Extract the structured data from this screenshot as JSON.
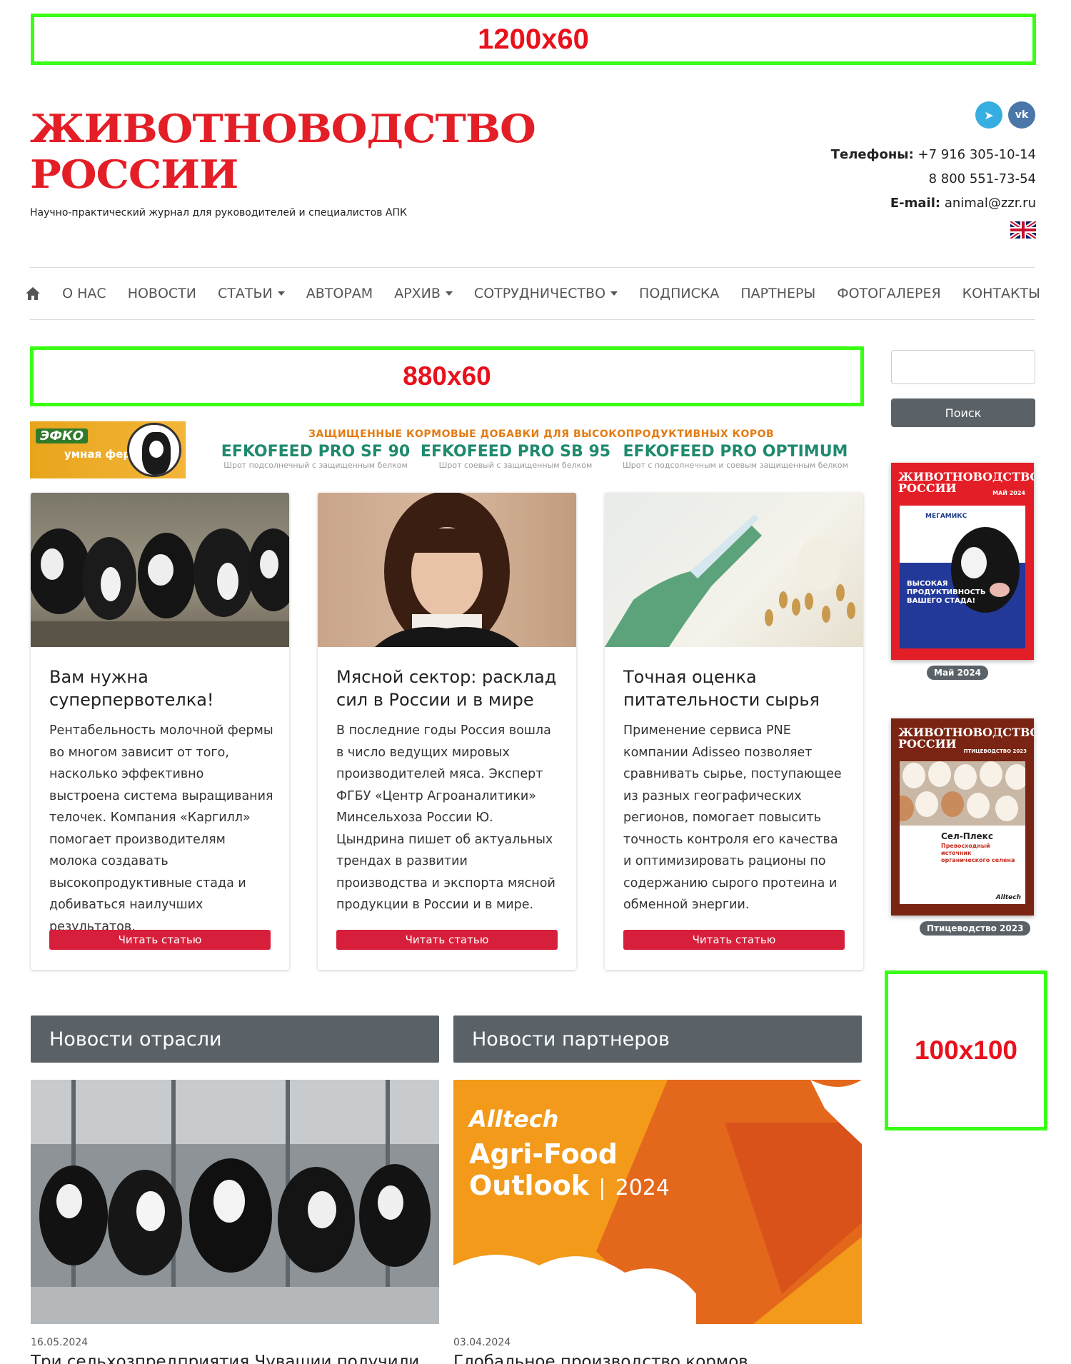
{
  "ads": {
    "top": "1200x60",
    "mid": "880x60",
    "side": "100x100"
  },
  "header": {
    "logo_line1": "ЖИВОТНОВОДСТВО",
    "logo_line2": "РОССИИ",
    "tagline": "Научно-практический журнал для руководителей и специалистов АПК",
    "social": [
      {
        "name": "telegram-icon",
        "glyph": "➤"
      },
      {
        "name": "vk-icon",
        "glyph": "vk"
      }
    ],
    "phones_label": "Телефоны:",
    "phone1": "+7 916 305-10-14",
    "phone2": "8 800 551-73-54",
    "email_label": "E-mail:",
    "email": "animal@zzr.ru"
  },
  "nav": {
    "home_icon": "⌂",
    "items": [
      "О НАС",
      "НОВОСТИ",
      "СТАТЬИ",
      "АВТОРАМ",
      "АРХИВ",
      "СОТРУДНИЧЕСТВО",
      "ПОДПИСКА",
      "ПАРТНЕРЫ",
      "ФОТОГАЛЕРЕЯ",
      "КОНТАКТЫ"
    ]
  },
  "search": {
    "placeholder": "",
    "button": "Поиск"
  },
  "banner": {
    "brand": "ЭФКО",
    "farm": "умная ферма",
    "headline": "ЗАЩИЩЕННЫЕ КОРМОВЫЕ ДОБАВКИ ДЛЯ ВЫСОКОПРОДУКТИВНЫХ КОРОВ",
    "products": [
      {
        "name": "EFKOFEED PRO SF 90",
        "desc": "Шрот подсолнечный с защищенным белком"
      },
      {
        "name": "EFKOFEED PRO SB 95",
        "desc": "Шрот соевый с защищенным белком"
      },
      {
        "name": "EFKOFEED PRO OPTIMUM",
        "desc": "Шрот с подсолнечным и соевым защищенным белком"
      }
    ]
  },
  "articles": [
    {
      "title": "Вам нужна суперпервотелка!",
      "text": "Рентабельность молочной фермы во многом зависит от того, насколько эффективно выстроена система выращивания телочек. Компания «Каргилл» помогает производителям молока создавать высокопродуктивные стада и добиваться наилучших результатов.",
      "button": "Читать статью"
    },
    {
      "title": "Мясной сектор: расклад сил в России и в мире",
      "text": "В последние годы Россия вошла в число ведущих мировых производителей мяса. Эксперт ФГБУ «Центр Агроаналитики» Минсельхоза России Ю. Цындрина пишет об актуальных трендах в развитии производства и экспорта мясной продукции в России и в мире.",
      "button": "Читать статью"
    },
    {
      "title": "Точная оценка питательности сырья",
      "text": "Применение сервиса PNE компании Adisseo позволяет сравнивать сырье, поступающее из разных географических регионов, помогает повысить точность контроля его качества и оптимизировать рационы по содержанию сырого протеина и обменной энергии.",
      "button": "Читать статью"
    }
  ],
  "sections": {
    "industry_news": "Новости отрасли",
    "partner_news": "Новости партнеров"
  },
  "news": [
    {
      "date": "16.05.2024",
      "title": "Три сельхозпредприятия Чувашии получили"
    },
    {
      "date": "03.04.2024",
      "title": "Глобальное производство кормов",
      "img_brand": "Alltech",
      "img_line1": "Agri-Food",
      "img_line2": "Outlook",
      "img_year": "2024"
    }
  ],
  "covers": [
    {
      "title1": "ЖИВОТНОВОДСТВО",
      "title2": "РОССИИ",
      "issue": "МАЙ 2024",
      "sponsor": "МЕГАМИКС",
      "slogan": "ВЫСОКАЯ ПРОДУКТИВНОСТЬ ВАШЕГО СТАДА!",
      "badge": "Май 2024",
      "color": "#e41e26"
    },
    {
      "title1": "ЖИВОТНОВОДСТВО",
      "title2": "РОССИИ",
      "issue": "ПТИЦЕВОДСТВО 2023",
      "product": "Сел-Плекс",
      "product_tag": "Превосходный источник органического селена",
      "brand": "Alltech",
      "badge": "Птицеводство 2023",
      "color": "#7a2413"
    }
  ]
}
